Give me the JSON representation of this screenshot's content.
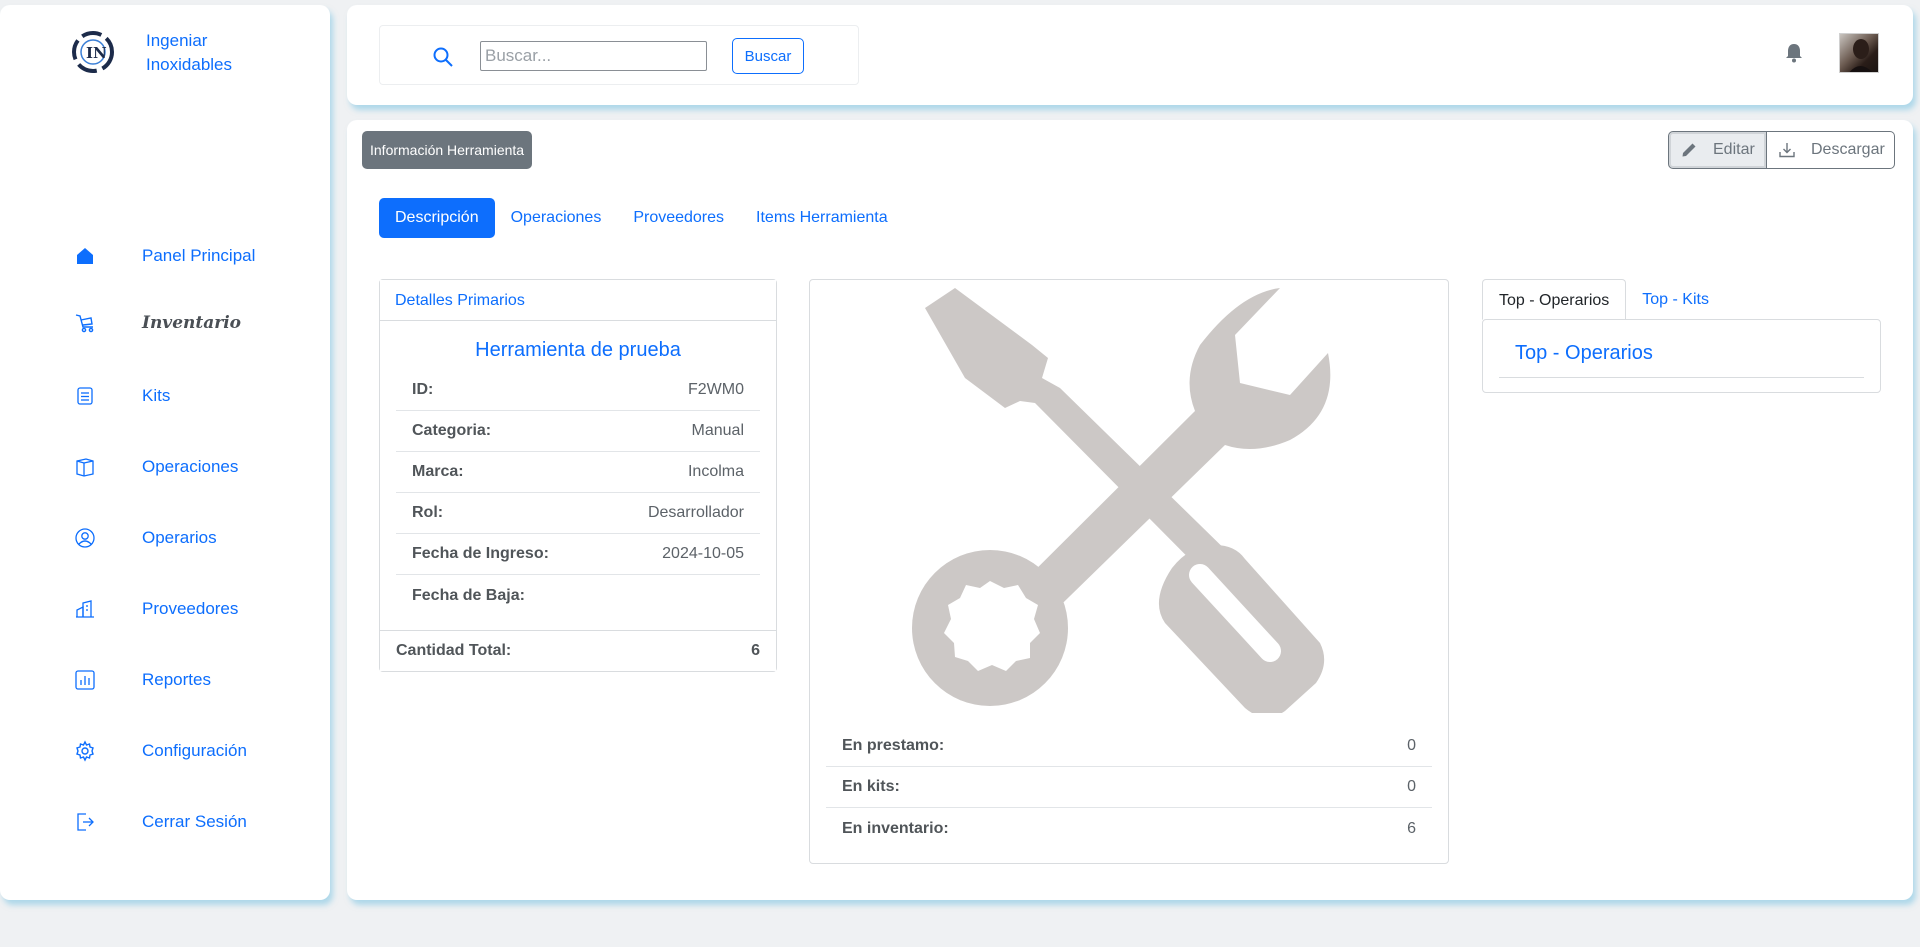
{
  "brand": {
    "name_line1": "Ingeniar",
    "name_line2": "Inoxidables",
    "logo_icon": "brand-logo-icon"
  },
  "sidebar": {
    "items": [
      {
        "label": "Panel Principal",
        "icon": "home-icon"
      },
      {
        "label": "Inventario",
        "icon": "tool-cart-icon"
      },
      {
        "label": "Kits",
        "icon": "checklist-icon"
      },
      {
        "label": "Operaciones",
        "icon": "box-icon"
      },
      {
        "label": "Operarios",
        "icon": "user-circle-icon"
      },
      {
        "label": "Proveedores",
        "icon": "building-icon"
      },
      {
        "label": "Reportes",
        "icon": "bar-chart-icon"
      },
      {
        "label": "Configuración",
        "icon": "gear-icon"
      },
      {
        "label": "Cerrar Sesión",
        "icon": "logout-icon"
      }
    ]
  },
  "search": {
    "placeholder": "Buscar...",
    "button_label": "Buscar"
  },
  "main": {
    "badge": "Información Herramienta",
    "actions": {
      "edit_label": "Editar",
      "download_label": "Descargar"
    },
    "tabs": [
      "Descripción",
      "Operaciones",
      "Proveedores",
      "Items Herramienta"
    ],
    "details": {
      "header": "Detalles Primarios",
      "title": "Herramienta de prueba",
      "rows": [
        {
          "label": "ID:",
          "value": "F2WM0"
        },
        {
          "label": "Categoria:",
          "value": "Manual"
        },
        {
          "label": "Marca:",
          "value": "Incolma"
        },
        {
          "label": "Rol:",
          "value": "Desarrollador"
        },
        {
          "label": "Fecha de Ingreso:",
          "value": "2024-10-05"
        },
        {
          "label": "Fecha de Baja:",
          "value": ""
        }
      ],
      "total_label": "Cantidad Total:",
      "total_value": "6"
    },
    "stock": {
      "rows": [
        {
          "label": "En prestamo:",
          "value": "0"
        },
        {
          "label": "En kits:",
          "value": "0"
        },
        {
          "label": "En inventario:",
          "value": "6"
        }
      ]
    },
    "side_tabs": [
      "Top - Operarios",
      "Top - Kits"
    ],
    "side_heading": "Top - Operarios"
  },
  "colors": {
    "accent": "#0d6efd",
    "secondary": "#6c757d",
    "tool_gray": "#ccc8c6"
  }
}
